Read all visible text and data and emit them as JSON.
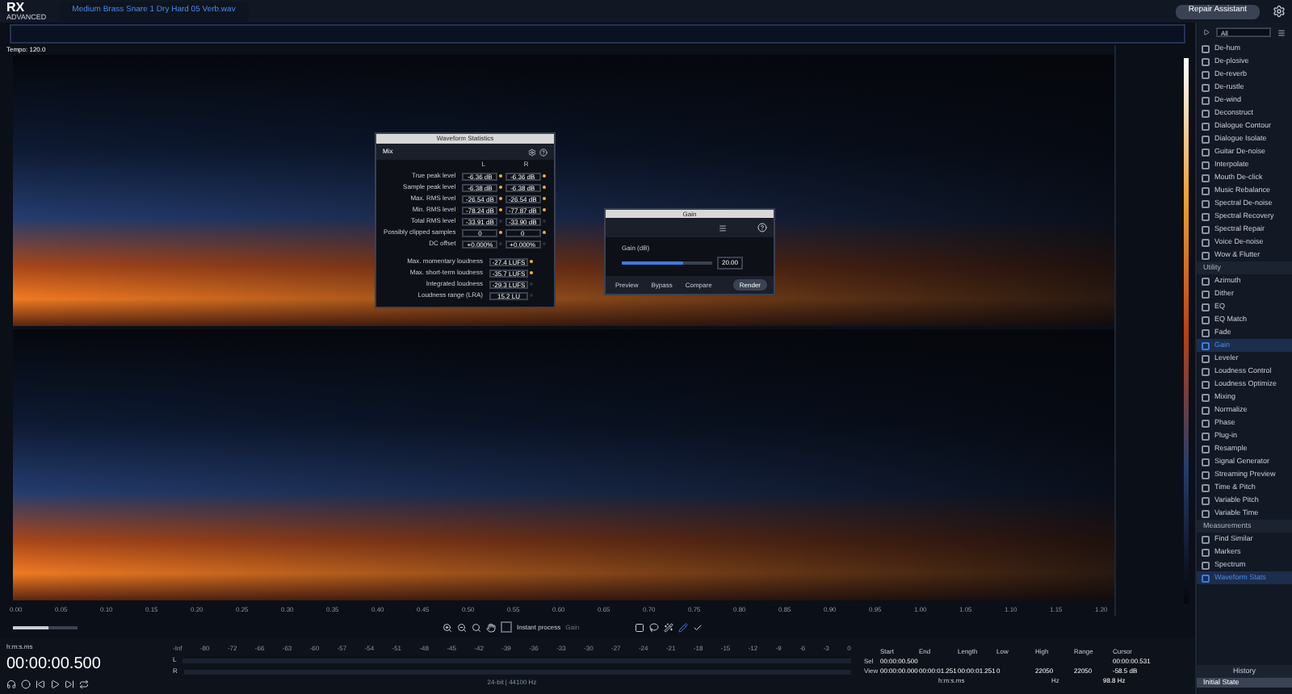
{
  "top_bar": {
    "logo": "RX",
    "logo_sub": "ADVANCED",
    "file_tab": "Medium Brass Snare 1 Dry Hard 05 Verb.wav",
    "repair_assistant": "Repair Assistant"
  },
  "tempo": "Tempo: 120.0",
  "time_ruler": [
    "0.00",
    "0.05",
    "0.10",
    "0.15",
    "0.20",
    "0.25",
    "0.30",
    "0.35",
    "0.40",
    "0.45",
    "0.50",
    "0.55",
    "0.60",
    "0.65",
    "0.70",
    "0.75",
    "0.80",
    "0.85",
    "0.90",
    "0.95",
    "1.00",
    "1.05",
    "1.10",
    "1.15",
    "1.20"
  ],
  "waveform_stats": {
    "title": "Waveform Statistics",
    "channel": "Mix",
    "columns": [
      "L",
      "R"
    ],
    "rows": [
      {
        "label": "True peak level",
        "values": [
          "-6.36 dB",
          "-6.36 dB"
        ],
        "flag": true
      },
      {
        "label": "Sample peak level",
        "values": [
          "-6.38 dB",
          "-6.38 dB"
        ],
        "flag": true
      },
      {
        "label": "Max. RMS level",
        "values": [
          "-26.54 dB",
          "-26.54 dB"
        ],
        "flag": true
      },
      {
        "label": "Min. RMS level",
        "values": [
          "-78.24 dB",
          "-77.87 dB"
        ],
        "flag": true
      },
      {
        "label": "Total RMS level",
        "values": [
          "-33.91 dB",
          "-33.90 dB"
        ],
        "flag": false
      },
      {
        "label": "Possibly clipped samples",
        "values": [
          "0",
          "0"
        ],
        "flag": true
      },
      {
        "label": "DC offset",
        "values": [
          "+0.000%",
          "+0.000%"
        ],
        "flag": false
      }
    ],
    "loudness": [
      {
        "label": "Max. momentary loudness",
        "value": "-27.4 LUFS",
        "flag": true
      },
      {
        "label": "Max. short-term loudness",
        "value": "-35.7 LUFS",
        "flag": true
      },
      {
        "label": "Integrated loudness",
        "value": "-29.3 LUFS",
        "flag": false
      },
      {
        "label": "Loudness range (LRA)",
        "value": "15.2 LU",
        "flag": false
      }
    ]
  },
  "gain_dialog": {
    "title": "Gain",
    "param": "Gain (dB)",
    "level": 0.68,
    "value": "20.00",
    "buttons": [
      "Preview",
      "Bypass",
      "Compare",
      "Render"
    ]
  },
  "toolbar": {
    "zoom": {
      "level": 0.55
    },
    "instant_process": {
      "label": "Instant process",
      "checked": false
    },
    "module": "Gain"
  },
  "transport": {
    "time_format": "h:m:s.ms",
    "time": "00:00:00.500"
  },
  "meter": {
    "ticks": [
      "-Inf",
      "-80",
      "-72",
      "-66",
      "-63",
      "-60",
      "-57",
      "-54",
      "-51",
      "-48",
      "-45",
      "-42",
      "-39",
      "-36",
      "-33",
      "-30",
      "-27",
      "-24",
      "-21",
      "-18",
      "-15",
      "-12",
      "-9",
      "-6",
      "-3",
      "0"
    ],
    "channels": [
      "L",
      "R"
    ],
    "format": "24-bit | 44100 Hz"
  },
  "selection": {
    "headers": [
      "Start",
      "End",
      "Length",
      "Low",
      "High",
      "Range",
      "Cursor"
    ],
    "rows": [
      {
        "label": "Sel",
        "start": "00:00:00.500",
        "cursor": "00:00:00.531"
      },
      {
        "label": "View",
        "start": "00:00:00.000",
        "end": "00:00:01.251",
        "length": "00:00:01.251",
        "low": "0",
        "high": "22050",
        "range": "22050",
        "cursor": "-58.5 dB"
      }
    ],
    "units": [
      "h:m:s.ms",
      "Hz",
      "98.8 Hz"
    ]
  },
  "module_filter": "All",
  "modules": [
    {
      "kind": "item",
      "label": "De-hum",
      "selected": false
    },
    {
      "kind": "item",
      "label": "De-plosive",
      "selected": false
    },
    {
      "kind": "item",
      "label": "De-reverb",
      "selected": false
    },
    {
      "kind": "item",
      "label": "De-rustle",
      "selected": false
    },
    {
      "kind": "item",
      "label": "De-wind",
      "selected": false
    },
    {
      "kind": "item",
      "label": "Deconstruct",
      "selected": false
    },
    {
      "kind": "item",
      "label": "Dialogue Contour",
      "selected": false
    },
    {
      "kind": "item",
      "label": "Dialogue Isolate",
      "selected": false
    },
    {
      "kind": "item",
      "label": "Guitar De-noise",
      "selected": false
    },
    {
      "kind": "item",
      "label": "Interpolate",
      "selected": false
    },
    {
      "kind": "item",
      "label": "Mouth De-click",
      "selected": false
    },
    {
      "kind": "item",
      "label": "Music Rebalance",
      "selected": false
    },
    {
      "kind": "item",
      "label": "Spectral De-noise",
      "selected": false
    },
    {
      "kind": "item",
      "label": "Spectral Recovery",
      "selected": false
    },
    {
      "kind": "item",
      "label": "Spectral Repair",
      "selected": false
    },
    {
      "kind": "item",
      "label": "Voice De-noise",
      "selected": false
    },
    {
      "kind": "item",
      "label": "Wow & Flutter",
      "selected": false
    },
    {
      "kind": "section",
      "label": "Utility"
    },
    {
      "kind": "item",
      "label": "Azimuth",
      "selected": false
    },
    {
      "kind": "item",
      "label": "Dither",
      "selected": false
    },
    {
      "kind": "item",
      "label": "EQ",
      "selected": false
    },
    {
      "kind": "item",
      "label": "EQ Match",
      "selected": false
    },
    {
      "kind": "item",
      "label": "Fade",
      "selected": false
    },
    {
      "kind": "item",
      "label": "Gain",
      "selected": true
    },
    {
      "kind": "item",
      "label": "Leveler",
      "selected": false
    },
    {
      "kind": "item",
      "label": "Loudness Control",
      "selected": false
    },
    {
      "kind": "item",
      "label": "Loudness Optimize",
      "selected": false
    },
    {
      "kind": "item",
      "label": "Mixing",
      "selected": false
    },
    {
      "kind": "item",
      "label": "Normalize",
      "selected": false
    },
    {
      "kind": "item",
      "label": "Phase",
      "selected": false
    },
    {
      "kind": "item",
      "label": "Plug-in",
      "selected": false
    },
    {
      "kind": "item",
      "label": "Resample",
      "selected": false
    },
    {
      "kind": "item",
      "label": "Signal Generator",
      "selected": false
    },
    {
      "kind": "item",
      "label": "Streaming Preview",
      "selected": false
    },
    {
      "kind": "item",
      "label": "Time & Pitch",
      "selected": false
    },
    {
      "kind": "item",
      "label": "Variable Pitch",
      "selected": false
    },
    {
      "kind": "item",
      "label": "Variable Time",
      "selected": false
    },
    {
      "kind": "section",
      "label": "Measurements"
    },
    {
      "kind": "item",
      "label": "Find Similar",
      "selected": false
    },
    {
      "kind": "item",
      "label": "Markers",
      "selected": false
    },
    {
      "kind": "item",
      "label": "Spectrum",
      "selected": false
    },
    {
      "kind": "item",
      "label": "Waveform Stats",
      "selected": true
    }
  ],
  "history": {
    "title": "History",
    "items": [
      {
        "label": "Initial State",
        "selected": true
      }
    ]
  }
}
